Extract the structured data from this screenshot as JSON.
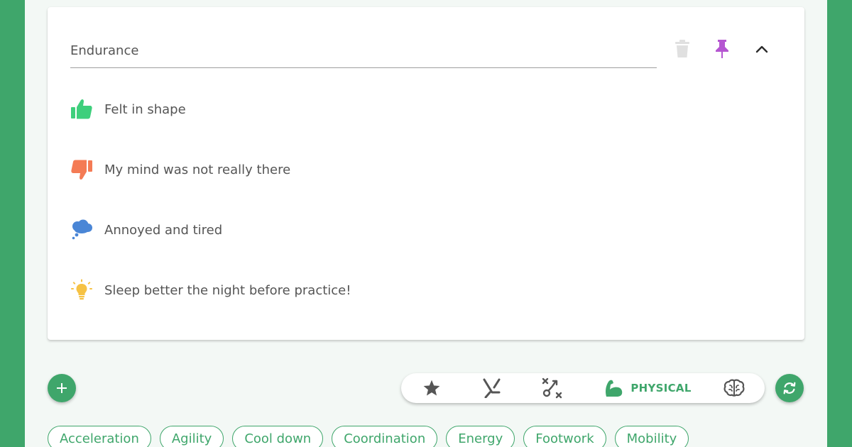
{
  "entry": {
    "title_value": "Endurance",
    "actions": {
      "delete_icon": "trash-icon",
      "pin_icon": "pin-icon",
      "collapse_icon": "chevron-up-icon"
    },
    "rows": [
      {
        "icon": "thumbs-up-icon",
        "text": "Felt in shape"
      },
      {
        "icon": "thumbs-down-icon",
        "text": "My mind was not really there"
      },
      {
        "icon": "thought-bubble-icon",
        "text": "Annoyed and tired"
      },
      {
        "icon": "lightbulb-icon",
        "text": "Sleep better the night before practice!"
      }
    ]
  },
  "toolbar": {
    "items": [
      {
        "icon": "star-icon"
      },
      {
        "icon": "hockey-stick-icon"
      },
      {
        "icon": "tactics-icon"
      },
      {
        "icon": "flexed-arm-icon",
        "label": "PHYSICAL",
        "selected": true
      },
      {
        "icon": "brain-icon"
      }
    ]
  },
  "add_button_icon": "plus-icon",
  "refresh_button_icon": "refresh-icon",
  "tags": [
    "Acceleration",
    "Agility",
    "Cool down",
    "Coordination",
    "Energy",
    "Footwork",
    "Mobility"
  ],
  "colors": {
    "brand_green": "#3fa66b",
    "thumbs_up": "#3ecf7c",
    "thumbs_down": "#f47b55",
    "thought": "#4a86d6",
    "lightbulb": "#f6c244",
    "pin": "#b556d1",
    "muted": "#e0e0e0"
  }
}
